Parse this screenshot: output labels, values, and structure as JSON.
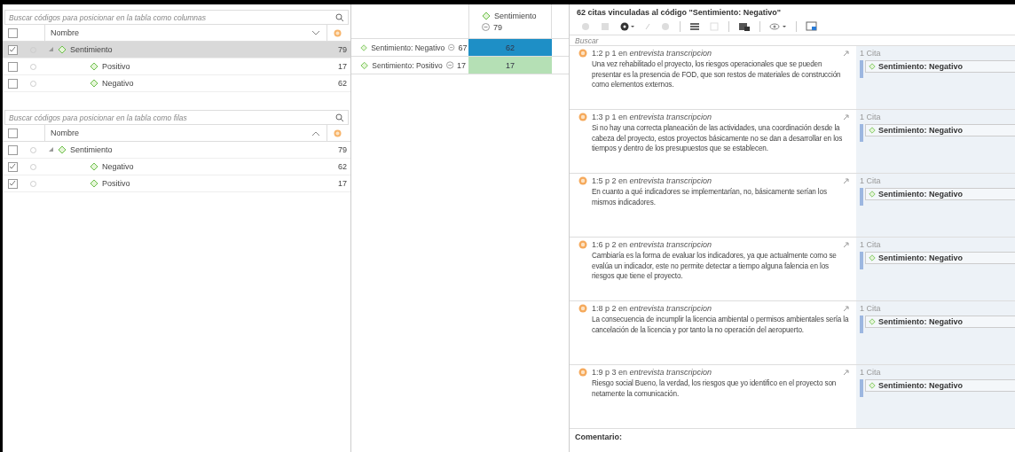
{
  "column_codes": {
    "search": {
      "placeholder": "Buscar códigos para posicionar en la tabla como columnas"
    },
    "header": {
      "name": "Nombre",
      "checked": false,
      "ascending": false
    },
    "tree": [
      {
        "name": "Sentimiento",
        "count": "79",
        "checked": true,
        "selected": true,
        "expanded": true,
        "children": [
          {
            "name": "Positivo",
            "count": "17",
            "checked": false,
            "selected": false
          },
          {
            "name": "Negativo",
            "count": "62",
            "checked": false,
            "selected": false
          }
        ]
      }
    ]
  },
  "row_codes": {
    "search": {
      "placeholder": "Buscar códigos para posicionar en la tabla como filas"
    },
    "header": {
      "name": "Nombre",
      "checked": false,
      "ascending": true
    },
    "tree": [
      {
        "name": "Sentimiento",
        "count": "79",
        "checked": false,
        "selected": false,
        "expanded": true,
        "children": [
          {
            "name": "Negativo",
            "count": "62",
            "checked": true,
            "selected": false
          },
          {
            "name": "Positivo",
            "count": "17",
            "checked": true,
            "selected": false
          }
        ]
      }
    ]
  },
  "table": {
    "column": {
      "name": "Sentimiento",
      "count": "79"
    },
    "rows": [
      {
        "name": "Sentimiento: Negativo",
        "count": "67",
        "cell": "62",
        "color": "#1e8fc6"
      },
      {
        "name": "Sentimiento: Positivo",
        "count": "17",
        "cell": "17",
        "color": "#b5e0b5"
      }
    ]
  },
  "quotes_panel": {
    "title": "62 citas vinculadas al código \"Sentimiento: Negativo\"",
    "search": {
      "placeholder": "Buscar"
    },
    "quotes": [
      {
        "ref": "1:2 p 1 en *entrevista transcripcion*",
        "text": "Una vez rehabilitado el proyecto, los riesgos operacionales que se pueden presentar es la presencia de FOD, que son restos de materiales de construcción como elementos externos.",
        "cita": "1 Cita",
        "code": "Sentimiento: Negativo"
      },
      {
        "ref": "1:3 p 1 en *entrevista transcripcion*",
        "text": "Si no hay una correcta planeación de las actividades, una coordinación desde la cabeza del proyecto, estos proyectos básicamente no se dan a desarrollar en los tiempos y dentro de los presupuestos que se establecen.",
        "cita": "1 Cita",
        "code": "Sentimiento: Negativo"
      },
      {
        "ref": "1:5 p 2 en *entrevista transcripcion*",
        "text": "En cuanto a qué indicadores se implementarían, no, básicamente serían los mismos indicadores.",
        "cita": "1 Cita",
        "code": "Sentimiento: Negativo"
      },
      {
        "ref": "1:6 p 2 en *entrevista transcripcion*",
        "text": "Cambiaría es la forma de evaluar los indicadores, ya que actualmente como se evalúa un indicador, este no permite detectar a tiempo alguna falencia en los riesgos que tiene el proyecto.",
        "cita": "1 Cita",
        "code": "Sentimiento: Negativo"
      },
      {
        "ref": "1:8 p 2 en *entrevista transcripcion*",
        "text": "La consecuencia de incumplir la licencia ambiental o permisos ambientales sería la cancelación de la licencia y por tanto la no operación del aeropuerto.",
        "cita": "1 Cita",
        "code": "Sentimiento: Negativo"
      },
      {
        "ref": "1:9 p 3 en *entrevista transcripcion*",
        "text": "Riesgo social  Bueno, la verdad, los riesgos que yo identifico en el proyecto son netamente la comunicación.",
        "cita": "1 Cita",
        "code": "Sentimiento: Negativo"
      }
    ],
    "comment_label": "Comentario:"
  }
}
